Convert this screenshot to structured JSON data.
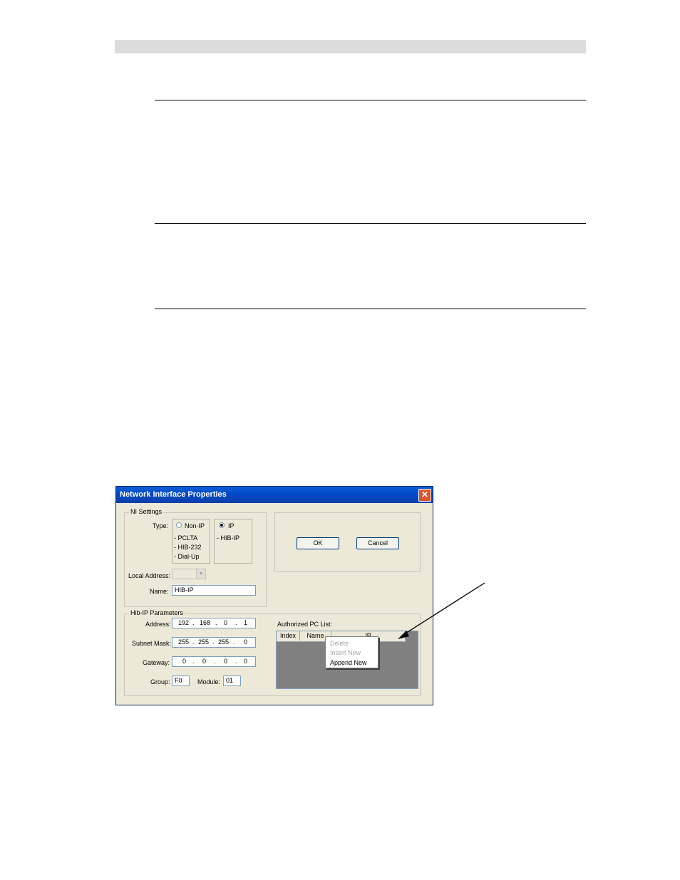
{
  "dialog": {
    "title": "Network Interface Properties",
    "close_glyph": "✕",
    "ni_settings": {
      "legend": "NI Settings",
      "type_label": "Type:",
      "non_ip_option": "Non-IP",
      "non_ip_items": [
        "- PCLTA",
        "- HIB-232",
        "- Dial-Up"
      ],
      "ip_option": "IP",
      "ip_items": [
        "- HIB-IP"
      ],
      "selected_type": "IP",
      "local_address_label": "Local Address:",
      "local_address_value": "",
      "name_label": "Name:",
      "name_value": "HIB-IP"
    },
    "ok_label": "OK",
    "cancel_label": "Cancel",
    "hib_ip": {
      "legend": "Hib-IP Parameters",
      "address_label": "Address:",
      "address": [
        "192",
        "168",
        "0",
        "1"
      ],
      "subnet_label": "Subnet Mask:",
      "subnet": [
        "255",
        "255",
        "255",
        "0"
      ],
      "gateway_label": "Gateway:",
      "gateway": [
        "0",
        "0",
        "0",
        "0"
      ],
      "group_label": "Group:",
      "group_value": "F0",
      "module_label": "Module:",
      "module_value": "01",
      "authorized_label": "Authorized PC List:",
      "columns": [
        "Index",
        "Name",
        "IP"
      ]
    },
    "context_menu": {
      "items": [
        {
          "label": "Delete",
          "enabled": false
        },
        {
          "label": "Insert New",
          "enabled": false
        },
        {
          "label": "Append New",
          "enabled": true
        }
      ]
    },
    "colors": {
      "titlebar": "#0a4fc8",
      "dialog_bg": "#ece9d8",
      "list_bg": "#808080"
    }
  }
}
